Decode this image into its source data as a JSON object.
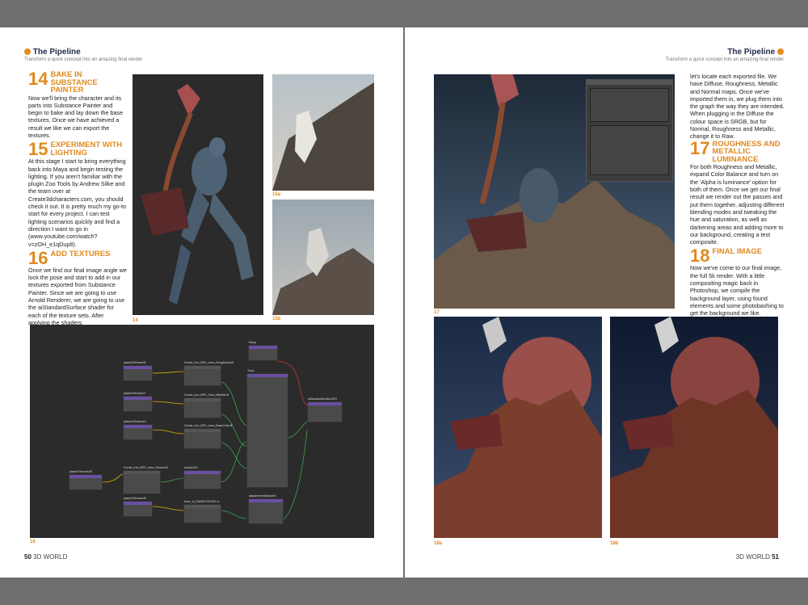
{
  "left_page": {
    "header": {
      "title": "The Pipeline",
      "subtitle": "Transform a quick concept into an amazing final render"
    },
    "sections": [
      {
        "num": "14",
        "heading": "Bake in Substance Painter",
        "body": "Now we'll bring the character and its parts into Substance Painter and begin to bake and lay down the base textures. Once we have achieved a result we like we can export the textures."
      },
      {
        "num": "15",
        "heading": "Experiment with lighting",
        "body": "At this stage I start to bring everything back into Maya and begin testing the lighting. If you aren't familiar with the plugin Zoo Tools by Andrew Silke and the team over at Create3dcharacters.com, you should check it out. It is pretty much my go-to start for every project. I can test lighting scenarios quickly and find a direction I want to go in (www.youtube.com/watch?v=zOH_e1qDup8)."
      },
      {
        "num": "16",
        "heading": "Add textures",
        "body": "Once we find our final image angle we lock the pose and start to add in our textures exported from Substance Painter. Since we are going to use Arnold Renderer, we are going to use the aiStandardSurface shader for each of the texture sets. After applying the shaders"
      }
    ],
    "captions": {
      "c14": "14",
      "c15a": "15a",
      "c15b": "15b",
      "c16": "16"
    },
    "folio": {
      "num": "50",
      "mag": "3D WORLD"
    }
  },
  "node_graph": {
    "nodes": [
      "place2dTexture30",
      "place2dTexture27",
      "place2dTexture15",
      "place2dTexture28",
      "place2dTexture48",
      "Gondo_Iron_BEG_torso_Roughness.tif",
      "Gondo_Iron_BEG_torso_Metallic.tif",
      "Gondo_Iron_BEG_torso_BaseColor.tif",
      "Gondo_Iron_BEG_torso_Normal.tif",
      "bump2d19",
      "torso_nl_DNNS47001001.tx",
      "Ramp",
      "Torso",
      "aiStandardSurface3SG",
      "displacementShader1"
    ]
  },
  "right_page": {
    "header": {
      "title": "The Pipeline",
      "subtitle": "Transform a quick concept into an amazing final render"
    },
    "intro": "let's locate each exported file. We have Diffuse, Roughness, Metallic and Normal maps. Once we've imported them in, we plug them into the graph the way they are intended. When plugging in the Diffuse the colour space is SRGB, but for Normal, Roughness and Metallic, change it to Raw.",
    "sections": [
      {
        "num": "17",
        "heading": "Roughness and Metallic luminance",
        "body": "For both Roughness and Metallic, expand Color Balance and turn on the 'Alpha is luminance' option for both of them. Once we get our final result we render out the passes and put them together, adjusting different blending modes and tweaking the hue and saturation, as well as darkening areas and adding more to our background, creating a test composite."
      },
      {
        "num": "18",
        "heading": "Final image",
        "body": "Now we've come to our final image, the full 5k render. With a little compositing magic back in Photoshop, we compile the background layer, using found elements and some photobashing to get the background we like."
      }
    ],
    "captions": {
      "c17": "17",
      "c18a": "18a",
      "c18b": "18b"
    },
    "folio": {
      "num": "51",
      "mag": "3D WORLD"
    }
  },
  "colors": {
    "accent": "#e08a1f",
    "header": "#1f2b4a",
    "page": "#ffffff",
    "surround": "#6e6e6e"
  }
}
